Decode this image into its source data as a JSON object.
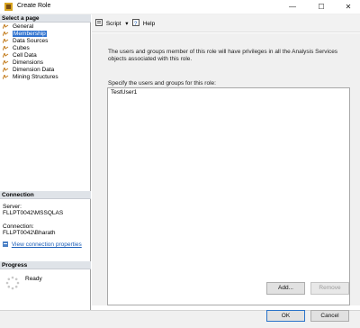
{
  "window": {
    "title": "Create Role",
    "minimize_glyph": "—",
    "maximize_glyph": "☐",
    "close_glyph": "✕"
  },
  "select_page": {
    "header": "Select a page",
    "items": [
      {
        "label": "General",
        "icon": "page-icon",
        "selected": false
      },
      {
        "label": "Membership",
        "icon": "page-icon",
        "selected": true
      },
      {
        "label": "Data Sources",
        "icon": "page-icon",
        "selected": false
      },
      {
        "label": "Cubes",
        "icon": "page-icon",
        "selected": false
      },
      {
        "label": "Cell Data",
        "icon": "page-icon",
        "selected": false
      },
      {
        "label": "Dimensions",
        "icon": "page-icon",
        "selected": false
      },
      {
        "label": "Dimension Data",
        "icon": "page-icon",
        "selected": false
      },
      {
        "label": "Mining Structures",
        "icon": "page-icon",
        "selected": false
      }
    ]
  },
  "connection": {
    "header": "Connection",
    "server_label": "Server:",
    "server_value": "FLLPT0042\\MSSQLAS",
    "connection_label": "Connection:",
    "connection_value": "FLLPT0042\\Bharath",
    "view_link": "View connection properties"
  },
  "progress": {
    "header": "Progress",
    "status": "Ready"
  },
  "toolbar": {
    "script_label": "Script",
    "help_label": "Help"
  },
  "main": {
    "description": "The users and groups member of this role will have privileges in all the Analysis Services objects associated with this role.",
    "specify_label": "Specify the users and groups for this role:",
    "users": [
      "TestUser1"
    ],
    "add_button": "Add...",
    "remove_button": "Remove"
  },
  "footer": {
    "ok_button": "OK",
    "cancel_button": "Cancel"
  },
  "colors": {
    "selection": "#3174d0",
    "link": "#1a5db8",
    "panel_header": "#dfe3e8",
    "content_bg": "#f0f0f0"
  }
}
